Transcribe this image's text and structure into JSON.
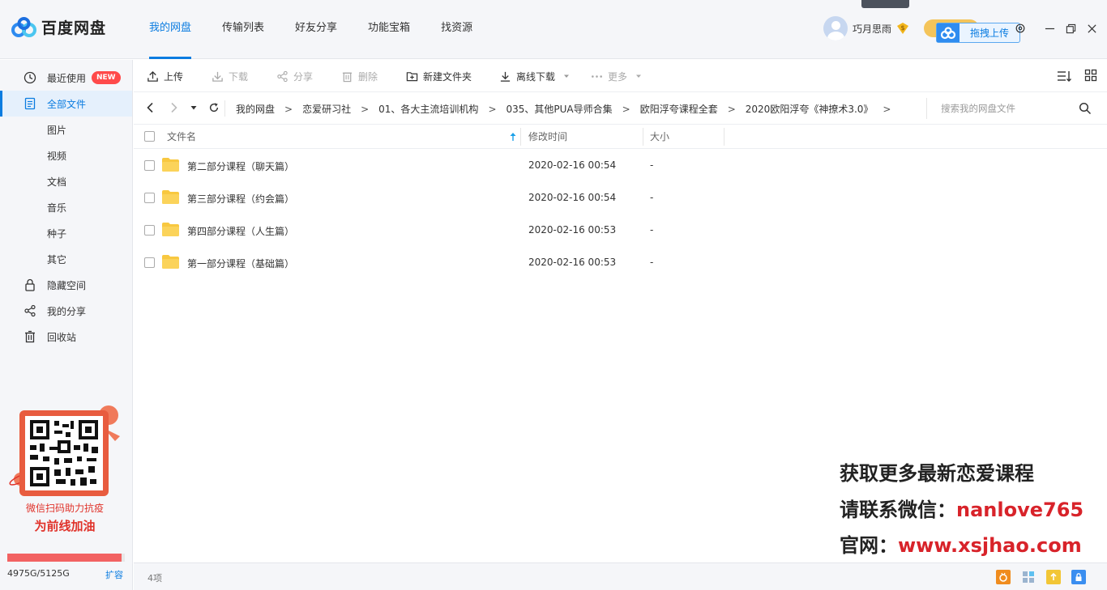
{
  "app": {
    "logo_text": "百度网盘"
  },
  "nav": {
    "items": [
      {
        "label": "我的网盘"
      },
      {
        "label": "传输列表"
      },
      {
        "label": "好友分享"
      },
      {
        "label": "功能宝箱"
      },
      {
        "label": "找资源"
      }
    ]
  },
  "user": {
    "name": "巧月思雨",
    "drag_upload_label": "拖拽上传"
  },
  "sidebar": {
    "items": [
      {
        "label": "最近使用",
        "badge": "NEW",
        "icon": "clock-icon"
      },
      {
        "label": "全部文件",
        "icon": "file-list-icon"
      },
      {
        "label": "图片"
      },
      {
        "label": "视频"
      },
      {
        "label": "文档"
      },
      {
        "label": "音乐"
      },
      {
        "label": "种子"
      },
      {
        "label": "其它"
      },
      {
        "label": "隐藏空间",
        "icon": "lock-icon"
      },
      {
        "label": "我的分享",
        "icon": "share-icon"
      },
      {
        "label": "回收站",
        "icon": "trash-icon"
      }
    ],
    "promo_line1": "微信扫码助力抗疫",
    "promo_line2": "为前线加油",
    "quota_text": "4975G/5125G",
    "quota_used_fraction": 0.9707,
    "expand_label": "扩容"
  },
  "toolbar": {
    "upload": "上传",
    "download": "下载",
    "share": "分享",
    "delete": "删除",
    "new_folder": "新建文件夹",
    "offline_download": "离线下载",
    "more": "更多"
  },
  "breadcrumb": {
    "items": [
      "我的网盘",
      "恋爱研习社",
      "01、各大主流培训机构",
      "035、其他PUA导师合集",
      "欧阳浮夸课程全套",
      "2020欧阳浮夸《神撩术3.0》"
    ],
    "separator": ">"
  },
  "search": {
    "placeholder": "搜索我的网盘文件"
  },
  "file_list": {
    "headers": {
      "name": "文件名",
      "modified": "修改时间",
      "size": "大小"
    },
    "rows": [
      {
        "name": "第二部分课程（聊天篇）",
        "modified": "2020-02-16 00:54",
        "size": "-"
      },
      {
        "name": "第三部分课程（约会篇）",
        "modified": "2020-02-16 00:54",
        "size": "-"
      },
      {
        "name": "第四部分课程（人生篇）",
        "modified": "2020-02-16 00:53",
        "size": "-"
      },
      {
        "name": "第一部分课程（基础篇）",
        "modified": "2020-02-16 00:53",
        "size": "-"
      }
    ]
  },
  "watermark": {
    "line1": "获取更多最新恋爱课程",
    "line2_prefix": "请联系微信：",
    "line2_value": "nanlove765",
    "line3_prefix": "官网：",
    "line3_value": "www.xsjhao.com"
  },
  "status": {
    "item_count": "4项"
  },
  "colors": {
    "accent": "#0b7ce0",
    "folder": "#f8c840",
    "badge_red": "#ff4a4a",
    "watermark_red": "#d8232a"
  }
}
